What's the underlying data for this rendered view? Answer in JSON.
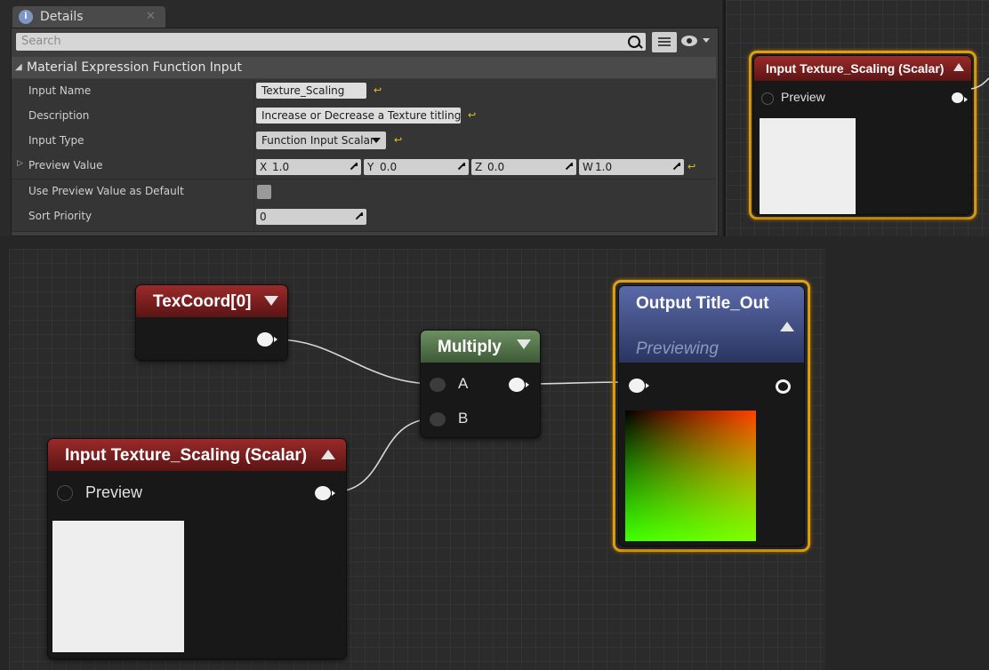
{
  "details": {
    "tab_title": "Details",
    "search_placeholder": "Search",
    "category": "Material Expression Function Input",
    "input_name_label": "Input Name",
    "input_name_value": "Texture_Scaling",
    "description_label": "Description",
    "description_value": "Increase or Decrease a Texture titling",
    "input_type_label": "Input Type",
    "input_type_value": "Function Input Scalar",
    "preview_value_label": "Preview Value",
    "preview": {
      "x_label": "X",
      "x": "1.0",
      "y_label": "Y",
      "y": "0.0",
      "z_label": "Z",
      "z": "0.0",
      "w_label": "W",
      "w": "1.0"
    },
    "use_preview_label": "Use Preview Value as Default",
    "sort_priority_label": "Sort Priority",
    "sort_priority_value": "0"
  },
  "nodes": {
    "mini_input": {
      "title": "Input Texture_Scaling (Scalar)",
      "pin": "Preview"
    },
    "texcoord": {
      "title": "TexCoord[0]"
    },
    "multiply": {
      "title": "Multiply",
      "pin_a": "A",
      "pin_b": "B"
    },
    "output": {
      "title": "Output Title_Out",
      "subtitle": "Previewing"
    },
    "input": {
      "title": "Input Texture_Scaling (Scalar)",
      "pin": "Preview"
    }
  },
  "colors": {
    "selection": "#e2a114",
    "input_header": "#8a2424",
    "multiply_header": "#5b7a52",
    "output_header": "#46558f"
  }
}
